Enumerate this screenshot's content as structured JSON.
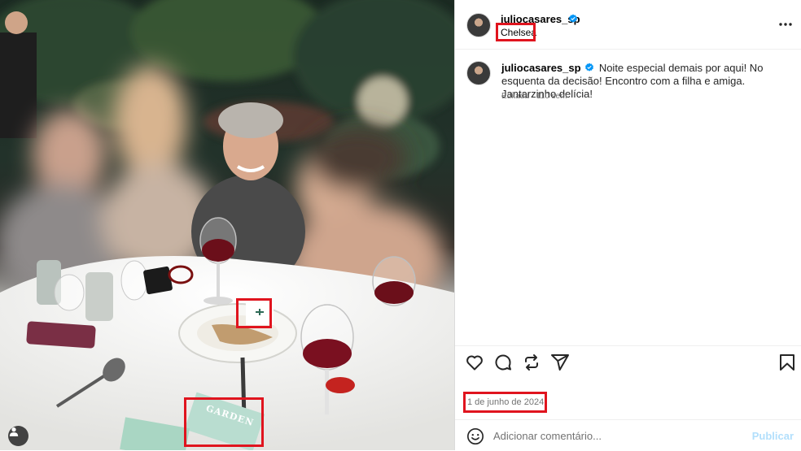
{
  "post": {
    "username": "juliocasares_sp",
    "location": "Chelsea",
    "caption": "Noite especial demais por aqui! No esquenta da decisão! Encontro com a filha e amiga. Jantarzinho delícia!",
    "edited_label": "Editada",
    "separator": "·",
    "age": "110 sem",
    "date": "1 de junho de 2024",
    "comment_placeholder": "Adicionar comentário...",
    "publish_label": "Publicar"
  },
  "photo": {
    "napkin_text": "GARDEN"
  },
  "icons": {
    "verified": "verified-badge-icon",
    "more": "more-options-icon",
    "like": "heart-icon",
    "comment": "comment-icon",
    "share": "repost-icon",
    "send": "send-icon",
    "save": "bookmark-icon",
    "emoji": "emoji-icon",
    "user_tag": "user-tag-icon"
  },
  "colors": {
    "verified": "#0095f6",
    "highlight": "#e0141e",
    "publish_disabled": "#b2dffc",
    "muted_text": "#737373"
  }
}
